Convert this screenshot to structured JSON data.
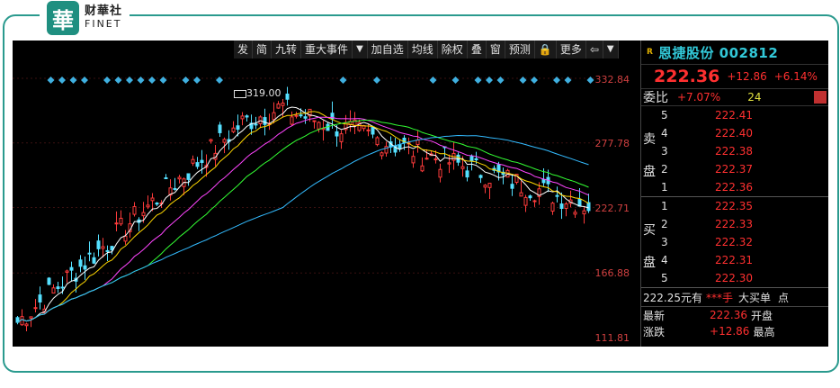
{
  "logo": {
    "mark": "華",
    "cn": "财華社",
    "en": "FINET"
  },
  "toolbar": [
    "发",
    "简",
    "九转",
    "重大事件",
    "▼",
    "加自选",
    "均线",
    "除权",
    "叠",
    "窗",
    "预测",
    "🔒",
    "更多",
    "⇦",
    "▼"
  ],
  "chart": {
    "axis_labels": [
      "332.84",
      "277.78",
      "222.71",
      "166.88",
      "111.81"
    ],
    "peak_label": "319.00"
  },
  "quote": {
    "r_tag": "R",
    "name": "恩捷股份 002812",
    "price": "222.36",
    "change": "+12.86",
    "change_pct": "+6.14%",
    "wb_label": "委比",
    "wb_value": "+7.07%",
    "wb_count": "24",
    "sell_label": "卖盘",
    "buy_label": "买盘",
    "sell": [
      {
        "level": "5",
        "price": "222.41"
      },
      {
        "level": "4",
        "price": "222.40"
      },
      {
        "level": "3",
        "price": "222.38"
      },
      {
        "level": "2",
        "price": "222.37"
      },
      {
        "level": "1",
        "price": "222.36"
      }
    ],
    "buy": [
      {
        "level": "1",
        "price": "222.35"
      },
      {
        "level": "2",
        "price": "222.33"
      },
      {
        "level": "3",
        "price": "222.32"
      },
      {
        "level": "4",
        "price": "222.31"
      },
      {
        "level": "5",
        "price": "222.30"
      }
    ],
    "big_order": {
      "price": "222.25元有",
      "qty": "***手",
      "label": "大买单",
      "tail": "点"
    },
    "latest_label": "最新",
    "latest_value": "222.36",
    "open_label": "开盘",
    "chg_label": "涨跌",
    "chg_value": "+12.86",
    "high_label": "最高"
  }
}
